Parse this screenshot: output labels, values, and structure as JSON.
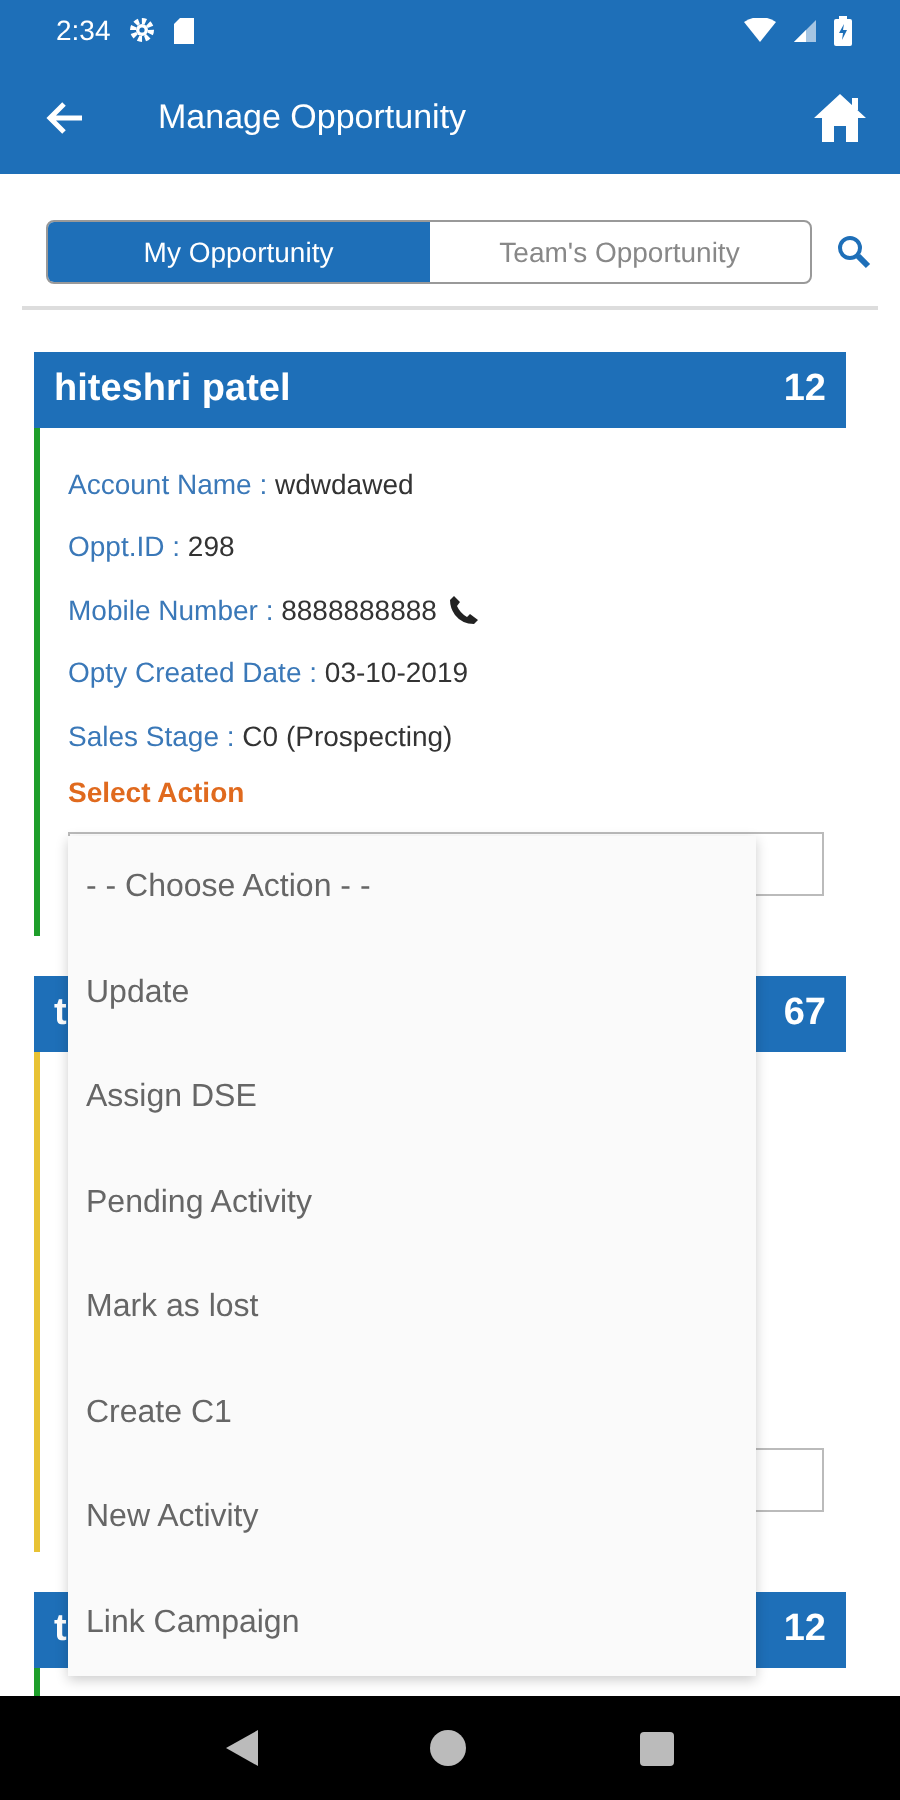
{
  "status_bar": {
    "time": "2:34"
  },
  "app_bar": {
    "title": "Manage Opportunity"
  },
  "tabs": [
    {
      "label": "My Opportunity",
      "selected": true
    },
    {
      "label": "Team's Opportunity",
      "selected": false
    }
  ],
  "cards": [
    {
      "title": "hiteshri patel",
      "count": "12",
      "color": "#1e9e2a",
      "fields": [
        {
          "label": "Account Name :",
          "value": "wdwdawed",
          "kind": "text"
        },
        {
          "label": "Oppt.ID :",
          "value": "298",
          "kind": "text"
        },
        {
          "label": "Mobile Number :",
          "value": "8888888888",
          "kind": "phone"
        },
        {
          "label": "Opty Created Date :",
          "value": "03-10-2019",
          "kind": "text"
        },
        {
          "label": "Sales Stage :",
          "value": "C0 (Prospecting)",
          "kind": "text"
        }
      ],
      "action_label": "Select Action"
    },
    {
      "title": "t",
      "count": "67",
      "color": "#e8c234"
    },
    {
      "title": "t",
      "count": "12",
      "color": "#1e9e2a"
    }
  ],
  "dropdown": {
    "options": [
      "- - Choose Action - -",
      "Update",
      "Assign DSE",
      "Pending Activity",
      "Mark as lost",
      "Create C1",
      "New Activity",
      "Link Campaign"
    ]
  }
}
